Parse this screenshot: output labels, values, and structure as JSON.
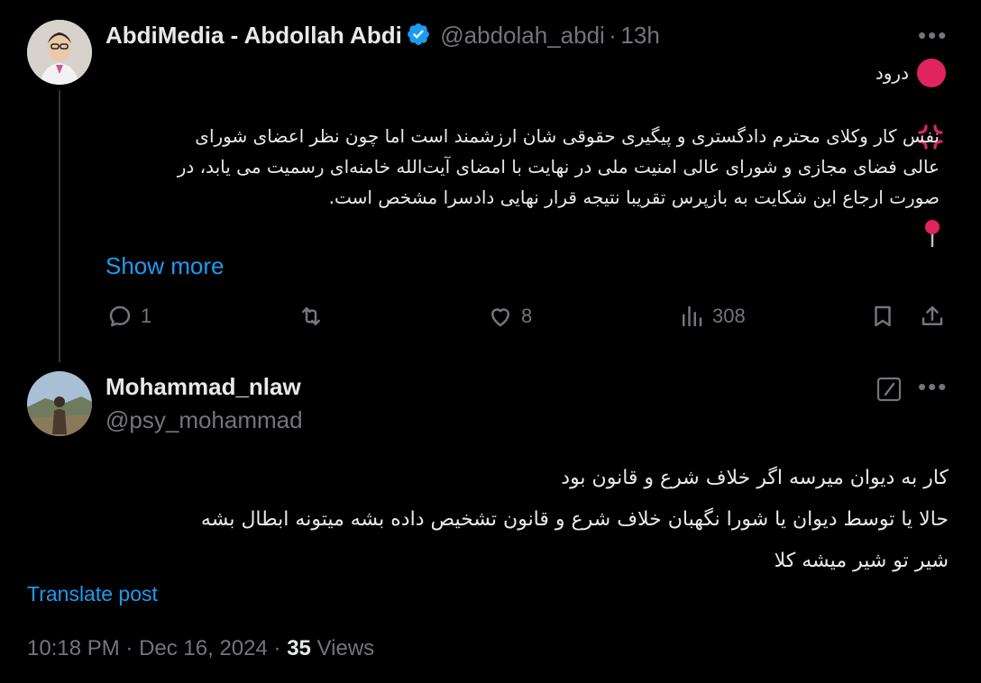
{
  "post": {
    "display_name": "AbdiMedia - Abdollah Abdi",
    "handle": "@abdolah_abdi",
    "separator": "·",
    "time_ago": "13h",
    "greeting": "درود",
    "body_lines": [
      "نفس کار وکلای محترم دادگستری و پیگیری حقوقی شان ارزشمند است اما چون نظر اعضای شورای",
      "عالی فضای مجازی و شورای عالی امنیت ملی در نهایت با امضای آیت‌الله خامنه‌ای رسمیت می یابد، در",
      "صورت ارجاع این شکایت به بازپرس تقریبا نتیجه قرار نهایی دادسرا مشخص است."
    ],
    "show_more": "Show more",
    "stats": {
      "replies": "1",
      "likes": "8",
      "views": "308"
    }
  },
  "reply": {
    "display_name": "Mohammad_nlaw",
    "handle": "@psy_mohammad",
    "lines": [
      "کار به دیوان میرسه اگر خلاف شرع و قانون بود",
      "حالا یا توسط دیوان یا شورا نگهبان خلاف شرع و قانون تشخیص داده بشه میتونه ابطال بشه",
      "شیر تو شیر میشه کلا"
    ],
    "translate": "Translate post",
    "time": "10:18 PM",
    "date": "Dec 16, 2024",
    "dot": "·",
    "views_count": "35",
    "views_label": "Views"
  },
  "colors": {
    "background": "#000000",
    "text": "#e7e9ea",
    "muted": "#71767b",
    "accent": "#1d9bf0",
    "red_dot": "#e0245e"
  },
  "icons": [
    "verified-badge-icon",
    "more-icon",
    "red-circle-icon",
    "anger-symbol-icon",
    "pin-icon",
    "reply-icon",
    "retweet-icon",
    "like-icon",
    "views-icon",
    "bookmark-icon",
    "share-icon",
    "edit-icon"
  ]
}
